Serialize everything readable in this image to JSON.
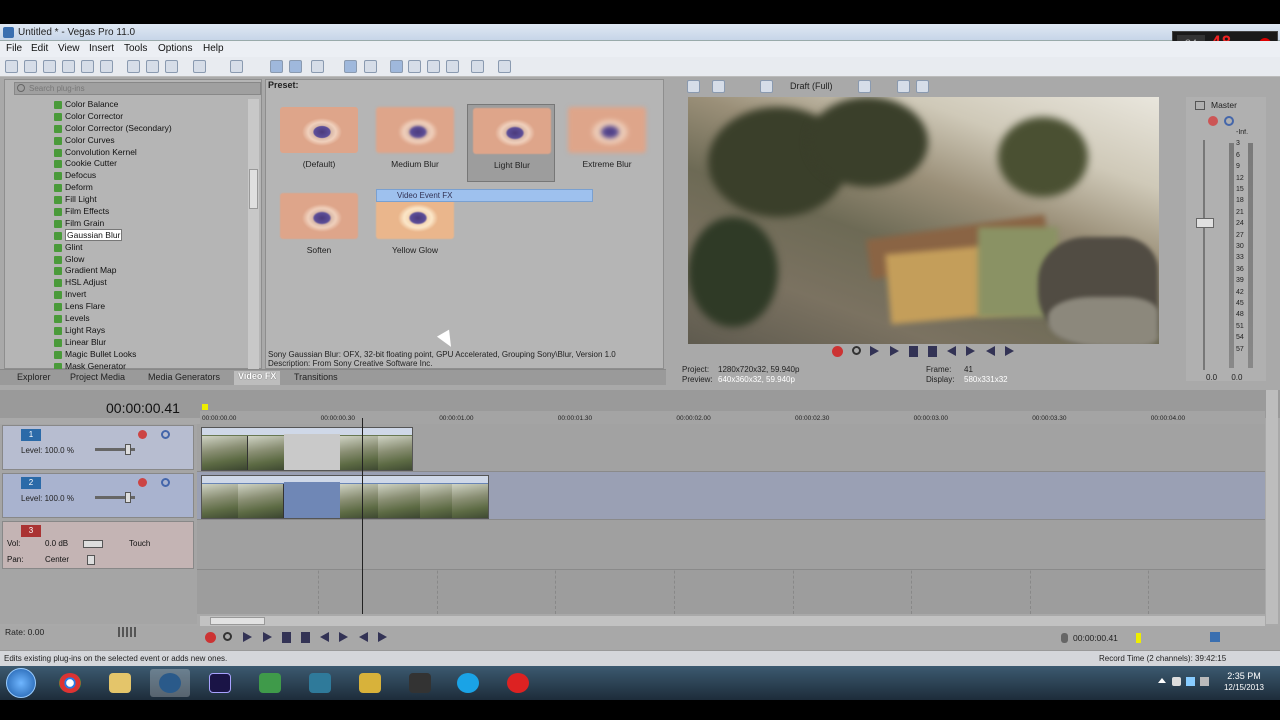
{
  "window": {
    "title": "Untitled * - Vegas Pro 11.0"
  },
  "recorder": {
    "fps_label": "34",
    "fps_value": "48"
  },
  "menu": [
    "File",
    "Edit",
    "View",
    "Insert",
    "Tools",
    "Options",
    "Help"
  ],
  "plugin_browser": {
    "search_placeholder": "Search plug-ins",
    "items": [
      "Color Balance",
      "Color Corrector",
      "Color Corrector (Secondary)",
      "Color Curves",
      "Convolution Kernel",
      "Cookie Cutter",
      "Defocus",
      "Deform",
      "Fill Light",
      "Film Effects",
      "Film Grain",
      "Gaussian Blur",
      "Glint",
      "Glow",
      "Gradient Map",
      "HSL Adjust",
      "Invert",
      "Lens Flare",
      "Levels",
      "Light Rays",
      "Linear Blur",
      "Magic Bullet Looks",
      "Mask Generator"
    ],
    "selected_index": 11
  },
  "presets": {
    "label": "Preset:",
    "items": [
      "(Default)",
      "Medium Blur",
      "Light Blur",
      "Extreme Blur",
      "Soften",
      "Yellow Glow"
    ],
    "highlighted": "Light Blur",
    "drag_ghost": "Video Event FX",
    "description_line1": "Sony Gaussian Blur: OFX, 32-bit floating point, GPU Accelerated, Grouping Sony\\Blur, Version 1.0",
    "description_line2": "Description: From Sony Creative Software Inc."
  },
  "dock_tabs": [
    "Explorer",
    "Project Media",
    "Media Generators",
    "Video FX",
    "Transitions"
  ],
  "dock_active": "Video FX",
  "preview": {
    "quality": "Draft (Full)",
    "project_label": "Project:",
    "project_value": "1280x720x32, 59.940p",
    "preview_label": "Preview:",
    "preview_value": "640x360x32, 59.940p",
    "frame_label": "Frame:",
    "frame_value": "41",
    "display_label": "Display:",
    "display_value": "580x331x32"
  },
  "mixer": {
    "title": "Master",
    "db_marks": [
      "-Inf.",
      "3",
      "6",
      "9",
      "12",
      "15",
      "18",
      "21",
      "24",
      "27",
      "30",
      "33",
      "36",
      "39",
      "42",
      "45",
      "48",
      "51",
      "54",
      "57"
    ],
    "left_value": "0.0",
    "right_value": "0.0"
  },
  "timeline": {
    "timecode": "00:00:00.41",
    "ruler": [
      "00:00:00.00",
      "00:00:00.30",
      "00:00:01.00",
      "00:00:01.30",
      "00:00:02.00",
      "00:00:02.30",
      "00:00:03.00",
      "00:00:03.30",
      "00:00:04.00"
    ],
    "tracks": [
      {
        "num": "1",
        "type": "video",
        "level": "Level: 100.0 %"
      },
      {
        "num": "2",
        "type": "video",
        "level": "Level: 100.0 %"
      },
      {
        "num": "3",
        "type": "audio",
        "vol_label": "Vol:",
        "vol_value": "0.0 dB",
        "pan_label": "Pan:",
        "pan_value": "Center",
        "mode": "Touch"
      }
    ],
    "rate": "Rate: 0.00",
    "end_time": "00:00:00.41"
  },
  "status": {
    "left": "Edits existing plug-ins on the selected event or adds new ones.",
    "right": "Record Time (2 channels): 39:42:15"
  },
  "taskbar": {
    "apps": [
      "windows-explorer",
      "chrome",
      "file-explorer",
      "vegas",
      "after-effects",
      "app-green",
      "app-edit",
      "app-yellow",
      "steam",
      "skype",
      "app-red"
    ],
    "time": "2:35 PM",
    "date": "12/15/2013"
  },
  "colors": {
    "accent": "#2b6aa8",
    "audio_track": "#a33",
    "rec_digits": "#e22"
  }
}
